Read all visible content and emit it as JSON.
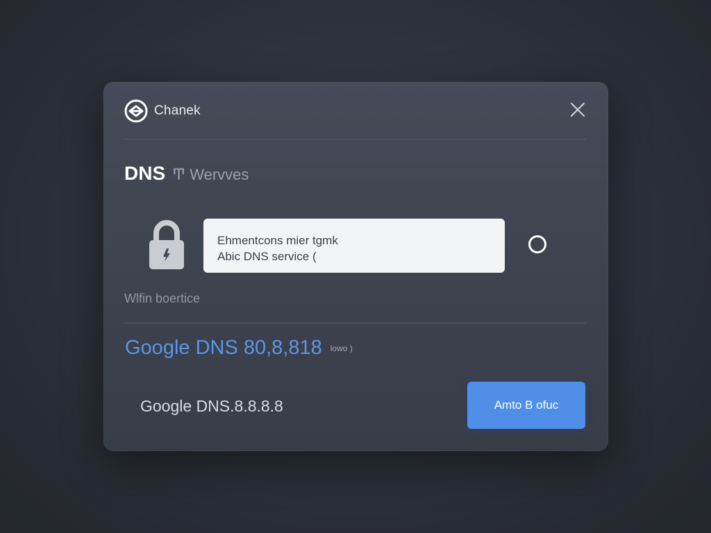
{
  "app": {
    "name": "Chanek",
    "logo_icon": "chain-link-logo-icon"
  },
  "header": {
    "close_icon": "close-icon"
  },
  "section": {
    "title": "DNS",
    "subtitle_mark": "Ͳ",
    "subtitle": "Wervves"
  },
  "info": {
    "icon": "lock-icon",
    "line1": "Ehmentcons mier tgmk",
    "line2": "Abic DNS service (",
    "radio_icon": "radio-unselected-icon"
  },
  "label": {
    "text": "Wlfin boertice"
  },
  "google_link": {
    "text": "Google DNS 80,8,818",
    "tag": "lowo )"
  },
  "selected_value": {
    "text": "Google DNS.8.8.8.8"
  },
  "action_button": {
    "label": "Amto B ofuc"
  },
  "colors": {
    "accent": "#4f8fe8",
    "link": "#5a96e6",
    "dialog_bg": "#414652",
    "page_bg": "#2c3039"
  }
}
